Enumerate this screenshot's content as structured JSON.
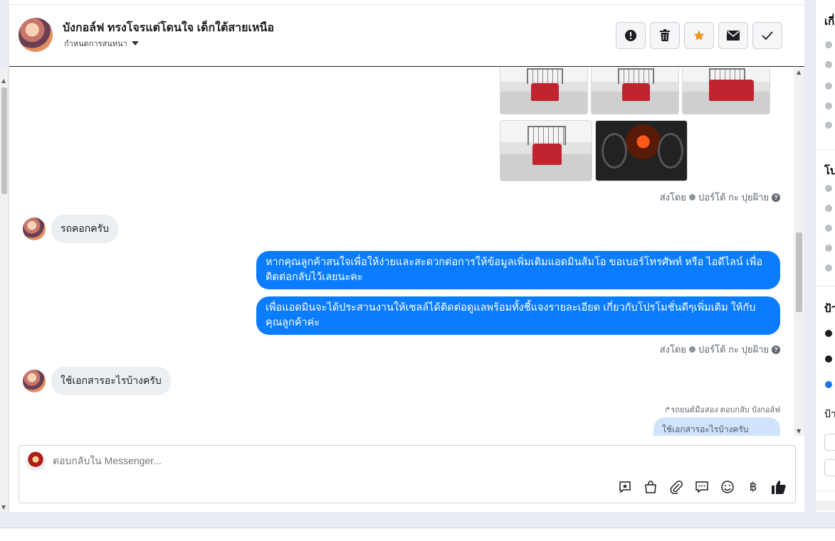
{
  "header": {
    "contact_name": "บังกอล์ฟ ทรงโจรแต่โดนใจ เด็กใต้สายเหนือ",
    "subtitle": "กำหนดการสนทนา",
    "actions": [
      "alert-icon",
      "trash-icon",
      "star-icon",
      "mail-icon",
      "check-icon"
    ],
    "accent_star": "#f0941e"
  },
  "conversation": {
    "sent_by_1": "ส่งโดย",
    "sent_by_agent_1": "ปอร์โต้ กะ ปุยฝ้าย",
    "incoming_1": "รถคอกครับ",
    "outgoing_1": "หากคุณลูกค้าสนใจเพื่อให้ง่ายและสะดวกต่อการให้ข้อมูลเพิ่มเติมแอดมินส้มโอ ขอเบอร์โทรศัพท์ หรือ ไอดีไลน์ เพื่อติดต่อกลับไว้เลยนะคะ",
    "outgoing_2": "เพื่อแอดมินจะได้ประสานงานให้เซลล์ได้ติดต่อดูแลพร้อมทั้งชี้แจงรายละเอียด เกี่ยวกับโปรโมชั่นดีๆเพิ่มเติม ให้กับคุณลูกค้าค่ะ",
    "sent_by_2": "ส่งโดย",
    "sent_by_agent_2": "ปอร์โต้ กะ ปุยฝ้าย",
    "incoming_2": "ใช้เอกสารอะไรบ้างครับ",
    "reply_note": "↱รถยนต์มือสอง ตอบกลับ บังกอล์ฟ",
    "reply_quote": "ใช้เอกสารอะไรบ้างครับ",
    "outgoing_color": "#0a7cff"
  },
  "composer": {
    "placeholder": "ตอบกลับใน Messenger...",
    "tools": [
      "saved-reply-icon",
      "shop-bag-icon",
      "attachment-icon",
      "chat-icon",
      "emoji-icon",
      "baht-icon",
      "like-icon"
    ]
  },
  "right_panel": {
    "heading_1": "เกี่",
    "heading_2": "โบ",
    "heading_3": "ป้า",
    "heading_4": "ป้า"
  }
}
